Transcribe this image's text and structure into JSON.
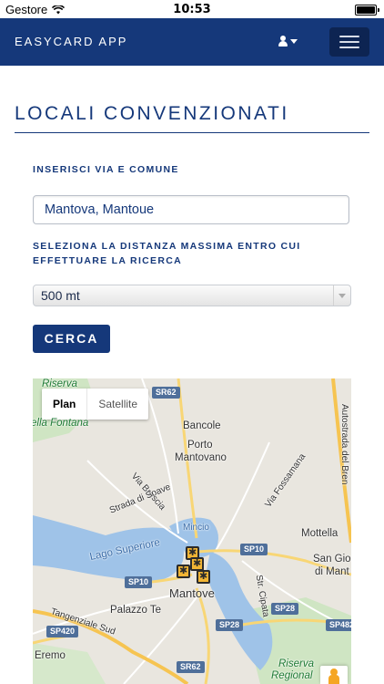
{
  "status_bar": {
    "carrier": "Gestore",
    "time": "10:53"
  },
  "navbar": {
    "brand": "EASYCARD APP"
  },
  "page": {
    "title": "LOCALI CONVENZIONATI"
  },
  "form": {
    "address_label": "INSERISCI VIA E COMUNE",
    "address_value": "Mantova, Mantoue",
    "distance_label_line1": "SELEZIONA LA DISTANZA MASSIMA ENTRO CUI",
    "distance_label_line2": "EFFETTUARE LA RICERCA",
    "distance_selected": "500 mt",
    "search_button": "CERCA"
  },
  "map": {
    "toggle": {
      "plan": "Plan",
      "satellite": "Satellite"
    },
    "labels": {
      "riserva": "Riserva",
      "della_fontana": "ella Fontana",
      "bancole": "Bancole",
      "porto": "Porto",
      "mantovano": "Mantovano",
      "via_brescia": "Via Brescia",
      "strada_soave": "Strada di Soave",
      "via_fossamana": "Via Fossamana",
      "autostrada": "Autostrada del Bren",
      "mincio": "Mincio",
      "lago_superiore": "Lago Superiore",
      "mottella": "Mottella",
      "san_gio": "San Gio",
      "di_mant": "di Mant",
      "mantova": "Mantove",
      "palazzo_te": "Palazzo Te",
      "tangenziale": "Tangenziale Sud",
      "eremo": "Eremo",
      "riserva_reg": "Riserva",
      "regional": "Regional",
      "strada_cipata": "Str. Cipata"
    },
    "road_shields": [
      "SR62",
      "SP10",
      "SP10",
      "SP28",
      "SP28",
      "SP420",
      "SR62",
      "SP482"
    ],
    "markers": 4
  },
  "colors": {
    "primary": "#15387a",
    "hamburger_bg": "#0d2452",
    "marker": "#f2b534"
  }
}
